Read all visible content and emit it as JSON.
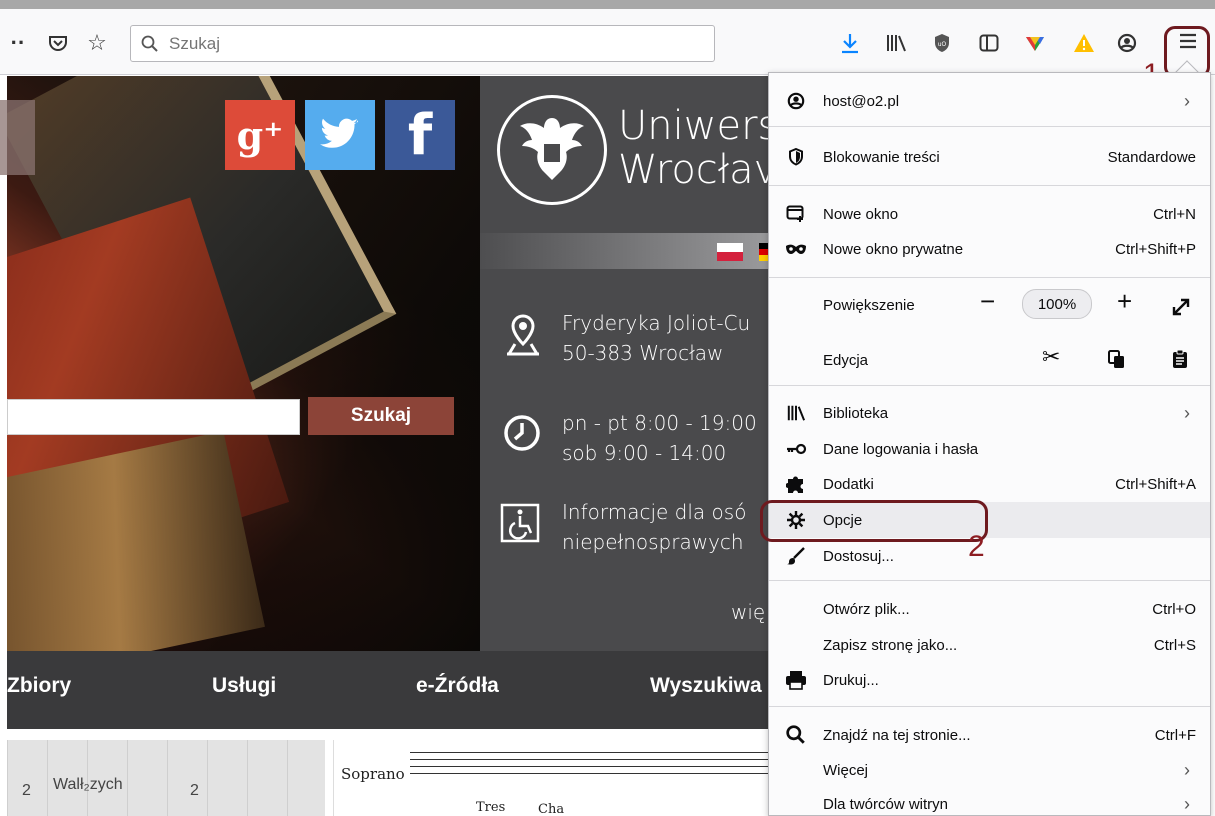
{
  "toolbar": {
    "overflow_glyph": "··",
    "search_placeholder": "Szukaj"
  },
  "annotations": {
    "step1": "1",
    "step2": "2"
  },
  "page": {
    "social": {
      "gplus": "g⁺",
      "twitter": "•",
      "facebook": "f"
    },
    "university_line1": "Uniwers",
    "university_line2": "Wrocłav",
    "address_line1": "Fryderyka Joliot-Cu",
    "address_line2": "50-383 Wrocław",
    "hours_line1": "pn - pt 8:00 - 19:00",
    "hours_line2": "sob 9:00 - 14:00",
    "access_line1": "Informacje dla osó",
    "access_line2": "niepełnosprawych",
    "more": "wię",
    "search_button": "Szukaj",
    "nav": [
      "Zbiory",
      "Usługi",
      "e-Źródła",
      "Wyszukiwa"
    ],
    "map_label": "Walł₂zych",
    "map_num1": "2",
    "map_num2": "2",
    "score_soprano": "Soprano",
    "score_tres": "Tres",
    "score_cha": "Cha"
  },
  "menu": {
    "account": "host@o2.pl",
    "content_blocking": "Blokowanie treści",
    "content_blocking_value": "Standardowe",
    "new_window": "Nowe okno",
    "new_window_sc": "Ctrl+N",
    "private_window": "Nowe okno prywatne",
    "private_window_sc": "Ctrl+Shift+P",
    "zoom": "Powiększenie",
    "zoom_value": "100%",
    "edit": "Edycja",
    "library": "Biblioteka",
    "logins": "Dane logowania i hasła",
    "addons": "Dodatki",
    "addons_sc": "Ctrl+Shift+A",
    "options": "Opcje",
    "customize": "Dostosuj...",
    "open_file": "Otwórz plik...",
    "open_file_sc": "Ctrl+O",
    "save_page": "Zapisz stronę jako...",
    "save_page_sc": "Ctrl+S",
    "print": "Drukuj...",
    "find": "Znajdź na tej stronie...",
    "find_sc": "Ctrl+F",
    "more": "Więcej",
    "developer": "Dla twórców witryn"
  },
  "colors": {
    "annotation": "#8d1d22",
    "search_button": "#8c4438",
    "download_icon": "#0a84ff",
    "warning_icon": "#ffbf00"
  }
}
